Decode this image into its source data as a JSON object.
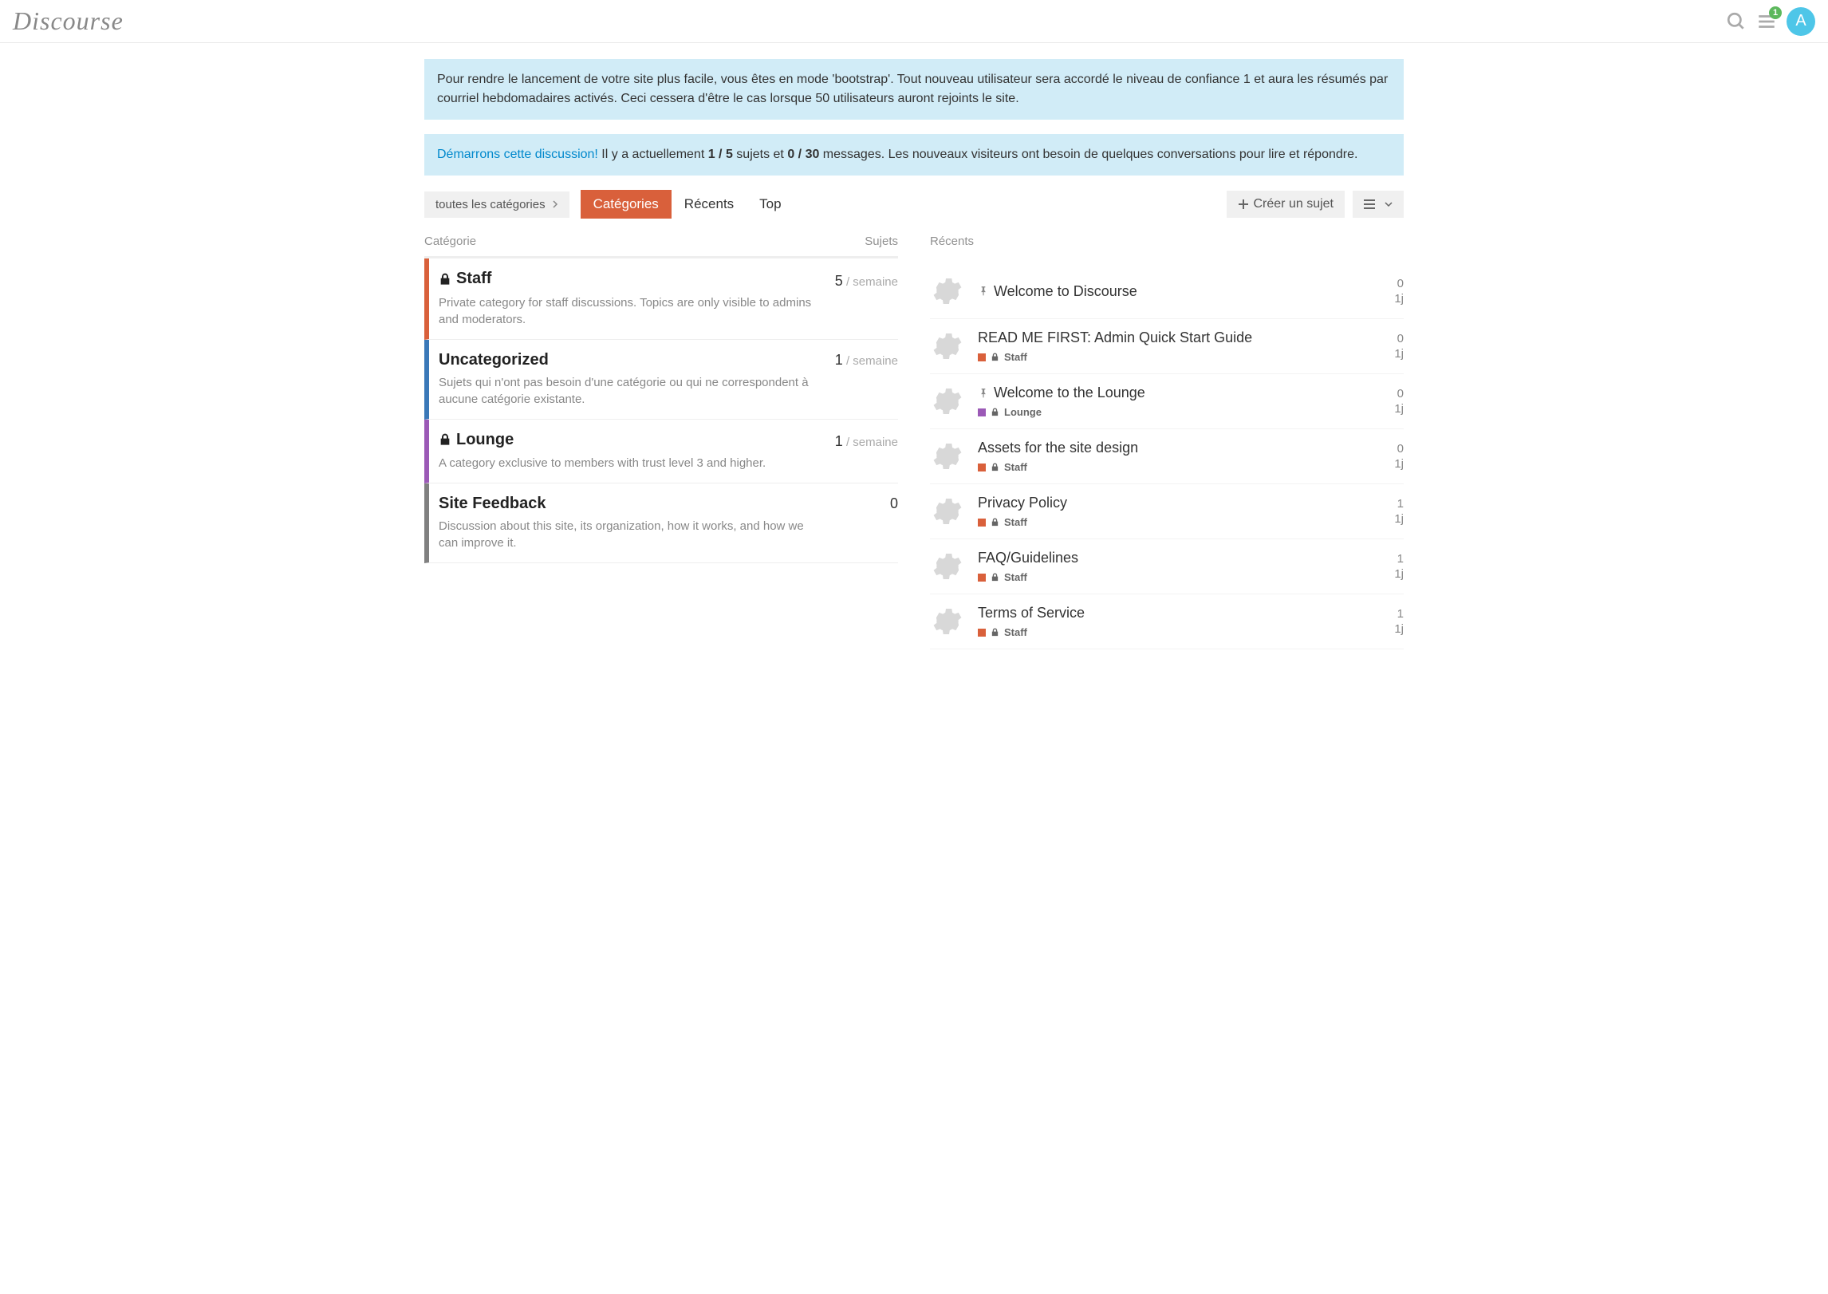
{
  "header": {
    "logo_text": "Discourse",
    "notification_count": "1",
    "avatar_letter": "A"
  },
  "alerts": {
    "bootstrap": "Pour rendre le lancement de votre site plus facile, vous êtes en mode 'bootstrap'. Tout nouveau utilisateur sera accordé le niveau de confiance 1 et aura les résumés par courriel hebdomadaires activés. Ceci cessera d'être le cas lorsque 50 utilisateurs auront rejoints le site.",
    "discussion_link": "Démarrons cette discussion!",
    "discussion_text_1": " Il y a actuellement ",
    "discussion_bold_1": "1 / 5",
    "discussion_text_2": " sujets et ",
    "discussion_bold_2": "0 / 30",
    "discussion_text_3": " messages. Les nouveaux visiteurs ont besoin de quelques conversations pour lire et répondre."
  },
  "nav": {
    "category_dropdown": "toutes les catégories",
    "tab_categories": "Catégories",
    "tab_recent": "Récents",
    "tab_top": "Top",
    "create_topic": "Créer un sujet"
  },
  "columns": {
    "category_label": "Catégorie",
    "topics_label": "Sujets",
    "recent_label": "Récents"
  },
  "colors": {
    "staff": "#d9603b",
    "uncategorized": "#3a78b8",
    "lounge": "#9b59b6",
    "feedback": "#808080"
  },
  "categories": [
    {
      "name": "Staff",
      "locked": true,
      "desc": "Private category for staff discussions. Topics are only visible to admins and moderators.",
      "count": "5",
      "per": " / semaine",
      "color": "#d9603b"
    },
    {
      "name": "Uncategorized",
      "locked": false,
      "desc": "Sujets qui n'ont pas besoin d'une catégorie ou qui ne correspondent à aucune catégorie existante.",
      "count": "1",
      "per": " / semaine",
      "color": "#3a78b8"
    },
    {
      "name": "Lounge",
      "locked": true,
      "desc": "A category exclusive to members with trust level 3 and higher.",
      "count": "1",
      "per": " / semaine",
      "color": "#9b59b6"
    },
    {
      "name": "Site Feedback",
      "locked": false,
      "desc": "Discussion about this site, its organization, how it works, and how we can improve it.",
      "count": "0",
      "per": "",
      "color": "#808080"
    }
  ],
  "topics": [
    {
      "title": "Welcome to Discourse",
      "pinned": true,
      "category": null,
      "cat_color": null,
      "cat_locked": false,
      "replies": "0",
      "age": "1j"
    },
    {
      "title": "READ ME FIRST: Admin Quick Start Guide",
      "pinned": false,
      "category": "Staff",
      "cat_color": "#d9603b",
      "cat_locked": true,
      "replies": "0",
      "age": "1j"
    },
    {
      "title": "Welcome to the Lounge",
      "pinned": true,
      "category": "Lounge",
      "cat_color": "#9b59b6",
      "cat_locked": true,
      "replies": "0",
      "age": "1j"
    },
    {
      "title": "Assets for the site design",
      "pinned": false,
      "category": "Staff",
      "cat_color": "#d9603b",
      "cat_locked": true,
      "replies": "0",
      "age": "1j"
    },
    {
      "title": "Privacy Policy",
      "pinned": false,
      "category": "Staff",
      "cat_color": "#d9603b",
      "cat_locked": true,
      "replies": "1",
      "age": "1j"
    },
    {
      "title": "FAQ/Guidelines",
      "pinned": false,
      "category": "Staff",
      "cat_color": "#d9603b",
      "cat_locked": true,
      "replies": "1",
      "age": "1j"
    },
    {
      "title": "Terms of Service",
      "pinned": false,
      "category": "Staff",
      "cat_color": "#d9603b",
      "cat_locked": true,
      "replies": "1",
      "age": "1j"
    }
  ]
}
